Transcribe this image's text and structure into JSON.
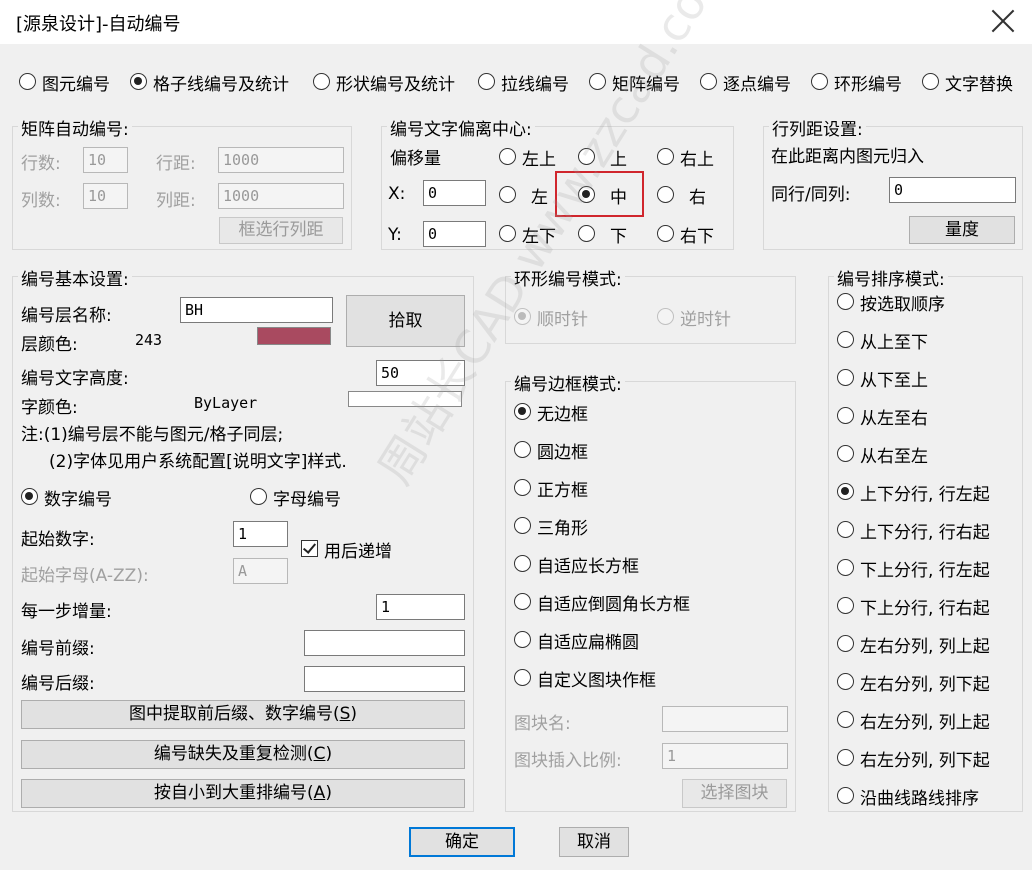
{
  "window": {
    "title": "[源泉设计]-自动编号"
  },
  "modes": [
    {
      "label": "图元编号",
      "selected": false
    },
    {
      "label": "格子线编号及统计",
      "selected": true
    },
    {
      "label": "形状编号及统计",
      "selected": false
    },
    {
      "label": "拉线编号",
      "selected": false
    },
    {
      "label": "矩阵编号",
      "selected": false
    },
    {
      "label": "逐点编号",
      "selected": false
    },
    {
      "label": "环形编号",
      "selected": false
    },
    {
      "label": "文字替换",
      "selected": false
    }
  ],
  "matrix": {
    "title": "矩阵自动编号:",
    "rows_label": "行数:",
    "rows_value": "10",
    "row_dist_label": "行距:",
    "row_dist_value": "1000",
    "cols_label": "列数:",
    "cols_value": "10",
    "col_dist_label": "列距:",
    "col_dist_value": "1000",
    "frame_btn": "框选行列距"
  },
  "offset": {
    "title": "编号文字偏离中心:",
    "offset_label": "偏移量",
    "x_label": "X:",
    "x_value": "0",
    "y_label": "Y:",
    "y_value": "0",
    "positions": [
      {
        "label": "左上",
        "selected": false
      },
      {
        "label": "上",
        "selected": false
      },
      {
        "label": "右上",
        "selected": false
      },
      {
        "label": "左",
        "selected": false
      },
      {
        "label": "中",
        "selected": true
      },
      {
        "label": "右",
        "selected": false
      },
      {
        "label": "左下",
        "selected": false
      },
      {
        "label": "下",
        "selected": false
      },
      {
        "label": "右下",
        "selected": false
      }
    ]
  },
  "spacing": {
    "title": "行列距设置:",
    "desc": "在此距离内图元归入",
    "same_label": "同行/同列:",
    "same_value": "0",
    "measure_btn": "量度"
  },
  "basic": {
    "title": "编号基本设置:",
    "layer_label": "编号层名称:",
    "layer_value": "BH",
    "pick_btn": "拾取",
    "layer_color_label": "层颜色:",
    "layer_color_value": "243",
    "layer_color_hex": "#a94a60",
    "text_height_label": "编号文字高度:",
    "text_height_value": "50",
    "text_color_label": "字颜色:",
    "text_color_value": "ByLayer",
    "note1": "注:(1)编号层不能与图元/格子同层;",
    "note2": "(2)字体见用户系统配置[说明文字]样式.",
    "numeric_label": "数字编号",
    "numeric_selected": true,
    "alpha_label": "字母编号",
    "alpha_selected": false,
    "start_num_label": "起始数字:",
    "start_num_value": "1",
    "auto_inc_label": "用后递增",
    "auto_inc_checked": true,
    "start_letter_label": "起始字母(A-ZZ):",
    "start_letter_value": "A",
    "step_label": "每一步增量:",
    "step_value": "1",
    "prefix_label": "编号前缀:",
    "prefix_value": "",
    "suffix_label": "编号后缀:",
    "suffix_value": ""
  },
  "bottom_buttons": {
    "extract_text": "图中提取前后缀、数字编号(",
    "extract_key": "S",
    "check_text": "编号缺失及重复检测(",
    "check_key": "C",
    "renumber_text": "按自小到大重排编号(",
    "renumber_key": "A",
    "close_paren": ")"
  },
  "ring": {
    "title": "环形编号模式:",
    "cw_label": "顺时针",
    "cw_selected": true,
    "ccw_label": "逆时针",
    "ccw_selected": false
  },
  "border": {
    "title": "编号边框模式:",
    "options": [
      {
        "label": "无边框",
        "selected": true
      },
      {
        "label": "圆边框",
        "selected": false
      },
      {
        "label": "正方框",
        "selected": false
      },
      {
        "label": "三角形",
        "selected": false
      },
      {
        "label": "自适应长方框",
        "selected": false
      },
      {
        "label": "自适应倒圆角长方框",
        "selected": false
      },
      {
        "label": "自适应扁椭圆",
        "selected": false
      },
      {
        "label": "自定义图块作框",
        "selected": false
      }
    ],
    "block_name_label": "图块名:",
    "block_name_value": "",
    "block_scale_label": "图块插入比例:",
    "block_scale_value": "1",
    "select_block_btn": "选择图块"
  },
  "sort": {
    "title": "编号排序模式:",
    "options": [
      {
        "label": "按选取顺序",
        "selected": false
      },
      {
        "label": "从上至下",
        "selected": false
      },
      {
        "label": "从下至上",
        "selected": false
      },
      {
        "label": "从左至右",
        "selected": false
      },
      {
        "label": "从右至左",
        "selected": false
      },
      {
        "label": "上下分行, 行左起",
        "selected": true
      },
      {
        "label": "上下分行, 行右起",
        "selected": false
      },
      {
        "label": "下上分行, 行左起",
        "selected": false
      },
      {
        "label": "下上分行, 行右起",
        "selected": false
      },
      {
        "label": "左右分列, 列上起",
        "selected": false
      },
      {
        "label": "左右分列, 列下起",
        "selected": false
      },
      {
        "label": "右左分列, 列上起",
        "selected": false
      },
      {
        "label": "右左分列, 列下起",
        "selected": false
      },
      {
        "label": "沿曲线路线排序",
        "selected": false
      }
    ]
  },
  "footer": {
    "ok": "确定",
    "cancel": "取消"
  },
  "watermark": "周站长CAD www.zzcad.com"
}
